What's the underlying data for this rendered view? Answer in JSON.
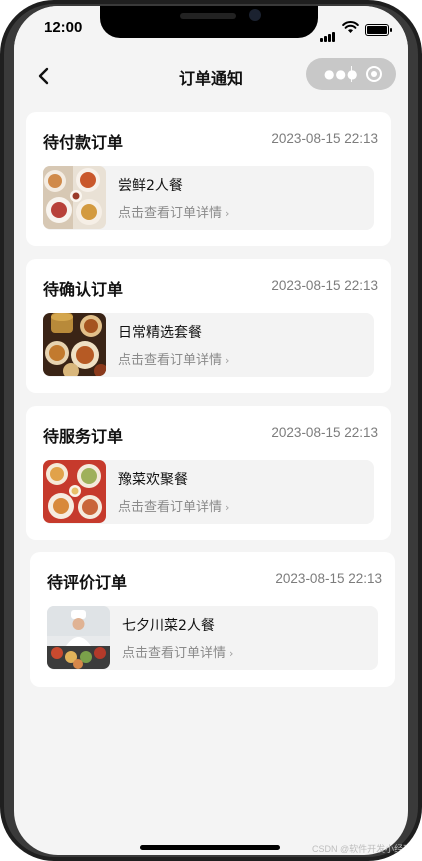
{
  "status_bar": {
    "time": "12:00"
  },
  "nav": {
    "title": "订单通知",
    "back_icon": "chevron-left-icon",
    "more_icon": "more-dots-icon",
    "close_icon": "target-circle-icon"
  },
  "orders": [
    {
      "title": "待付款订单",
      "time": "2023-08-15 22:13",
      "name": "尝鲜2人餐",
      "link": "点击查看订单详情",
      "thumb": "food-photo-1"
    },
    {
      "title": "待确认订单",
      "time": "2023-08-15 22:13",
      "name": "日常精选套餐",
      "link": "点击查看订单详情",
      "thumb": "food-photo-2"
    },
    {
      "title": "待服务订单",
      "time": "2023-08-15 22:13",
      "name": "豫菜欢聚餐",
      "link": "点击查看订单详情",
      "thumb": "food-photo-3"
    },
    {
      "title": "待评价订单",
      "time": "2023-08-15 22:13",
      "name": "七夕川菜2人餐",
      "link": "点击查看订单详情",
      "thumb": "chef-photo"
    }
  ],
  "chevron_glyph": "›",
  "watermark": "CSDN @软件开发小经理",
  "colors": {
    "background": "#f4f4f4",
    "card": "#ffffff",
    "item_bg": "#f3f3f3",
    "muted_text": "#8a8a8a"
  }
}
